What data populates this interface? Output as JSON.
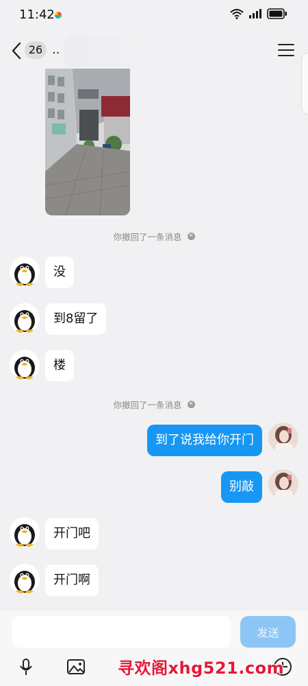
{
  "status_bar": {
    "time": "11:42"
  },
  "header": {
    "unread_count": "26",
    "title": ".."
  },
  "notices": {
    "recall_1": "你撤回了一条消息",
    "recall_2": "你撤回了一条消息"
  },
  "messages": [
    {
      "side": "in",
      "text": "没"
    },
    {
      "side": "in",
      "text": "到8留了"
    },
    {
      "side": "in",
      "text": "楼"
    },
    {
      "side": "out",
      "text": "到了说我给你开门"
    },
    {
      "side": "out",
      "text": "别敲"
    },
    {
      "side": "in",
      "text": "开门吧"
    },
    {
      "side": "in",
      "text": "开门啊"
    }
  ],
  "input": {
    "placeholder": "",
    "value": "",
    "send_label": "发送"
  },
  "toolbar": {
    "icons": [
      "microphone-icon",
      "image-icon",
      "add-icon"
    ],
    "watermark": "寻欢阁xhg521.com"
  },
  "colors": {
    "outgoing_bubble": "#1797f3",
    "send_button_disabled": "#8dc6f6",
    "watermark": "#e11b3a"
  }
}
